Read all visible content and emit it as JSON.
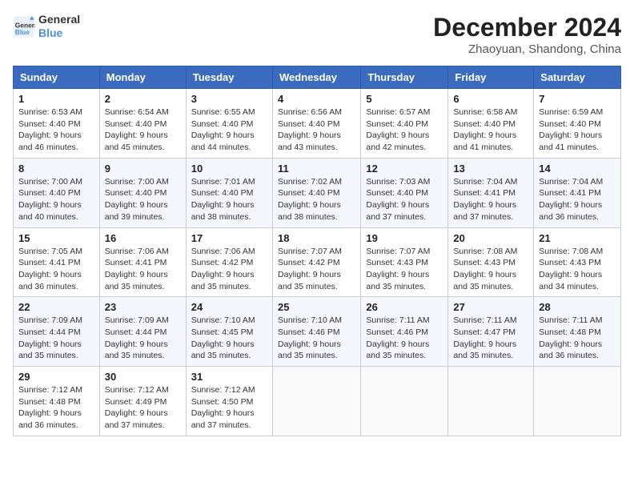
{
  "header": {
    "logo_line1": "General",
    "logo_line2": "Blue",
    "month_title": "December 2024",
    "location": "Zhaoyuan, Shandong, China"
  },
  "weekdays": [
    "Sunday",
    "Monday",
    "Tuesday",
    "Wednesday",
    "Thursday",
    "Friday",
    "Saturday"
  ],
  "weeks": [
    [
      {
        "day": "1",
        "sunrise": "6:53 AM",
        "sunset": "4:40 PM",
        "daylight": "9 hours and 46 minutes."
      },
      {
        "day": "2",
        "sunrise": "6:54 AM",
        "sunset": "4:40 PM",
        "daylight": "9 hours and 45 minutes."
      },
      {
        "day": "3",
        "sunrise": "6:55 AM",
        "sunset": "4:40 PM",
        "daylight": "9 hours and 44 minutes."
      },
      {
        "day": "4",
        "sunrise": "6:56 AM",
        "sunset": "4:40 PM",
        "daylight": "9 hours and 43 minutes."
      },
      {
        "day": "5",
        "sunrise": "6:57 AM",
        "sunset": "4:40 PM",
        "daylight": "9 hours and 42 minutes."
      },
      {
        "day": "6",
        "sunrise": "6:58 AM",
        "sunset": "4:40 PM",
        "daylight": "9 hours and 41 minutes."
      },
      {
        "day": "7",
        "sunrise": "6:59 AM",
        "sunset": "4:40 PM",
        "daylight": "9 hours and 41 minutes."
      }
    ],
    [
      {
        "day": "8",
        "sunrise": "7:00 AM",
        "sunset": "4:40 PM",
        "daylight": "9 hours and 40 minutes."
      },
      {
        "day": "9",
        "sunrise": "7:00 AM",
        "sunset": "4:40 PM",
        "daylight": "9 hours and 39 minutes."
      },
      {
        "day": "10",
        "sunrise": "7:01 AM",
        "sunset": "4:40 PM",
        "daylight": "9 hours and 38 minutes."
      },
      {
        "day": "11",
        "sunrise": "7:02 AM",
        "sunset": "4:40 PM",
        "daylight": "9 hours and 38 minutes."
      },
      {
        "day": "12",
        "sunrise": "7:03 AM",
        "sunset": "4:40 PM",
        "daylight": "9 hours and 37 minutes."
      },
      {
        "day": "13",
        "sunrise": "7:04 AM",
        "sunset": "4:41 PM",
        "daylight": "9 hours and 37 minutes."
      },
      {
        "day": "14",
        "sunrise": "7:04 AM",
        "sunset": "4:41 PM",
        "daylight": "9 hours and 36 minutes."
      }
    ],
    [
      {
        "day": "15",
        "sunrise": "7:05 AM",
        "sunset": "4:41 PM",
        "daylight": "9 hours and 36 minutes."
      },
      {
        "day": "16",
        "sunrise": "7:06 AM",
        "sunset": "4:41 PM",
        "daylight": "9 hours and 35 minutes."
      },
      {
        "day": "17",
        "sunrise": "7:06 AM",
        "sunset": "4:42 PM",
        "daylight": "9 hours and 35 minutes."
      },
      {
        "day": "18",
        "sunrise": "7:07 AM",
        "sunset": "4:42 PM",
        "daylight": "9 hours and 35 minutes."
      },
      {
        "day": "19",
        "sunrise": "7:07 AM",
        "sunset": "4:43 PM",
        "daylight": "9 hours and 35 minutes."
      },
      {
        "day": "20",
        "sunrise": "7:08 AM",
        "sunset": "4:43 PM",
        "daylight": "9 hours and 35 minutes."
      },
      {
        "day": "21",
        "sunrise": "7:08 AM",
        "sunset": "4:43 PM",
        "daylight": "9 hours and 34 minutes."
      }
    ],
    [
      {
        "day": "22",
        "sunrise": "7:09 AM",
        "sunset": "4:44 PM",
        "daylight": "9 hours and 35 minutes."
      },
      {
        "day": "23",
        "sunrise": "7:09 AM",
        "sunset": "4:44 PM",
        "daylight": "9 hours and 35 minutes."
      },
      {
        "day": "24",
        "sunrise": "7:10 AM",
        "sunset": "4:45 PM",
        "daylight": "9 hours and 35 minutes."
      },
      {
        "day": "25",
        "sunrise": "7:10 AM",
        "sunset": "4:46 PM",
        "daylight": "9 hours and 35 minutes."
      },
      {
        "day": "26",
        "sunrise": "7:11 AM",
        "sunset": "4:46 PM",
        "daylight": "9 hours and 35 minutes."
      },
      {
        "day": "27",
        "sunrise": "7:11 AM",
        "sunset": "4:47 PM",
        "daylight": "9 hours and 35 minutes."
      },
      {
        "day": "28",
        "sunrise": "7:11 AM",
        "sunset": "4:48 PM",
        "daylight": "9 hours and 36 minutes."
      }
    ],
    [
      {
        "day": "29",
        "sunrise": "7:12 AM",
        "sunset": "4:48 PM",
        "daylight": "9 hours and 36 minutes."
      },
      {
        "day": "30",
        "sunrise": "7:12 AM",
        "sunset": "4:49 PM",
        "daylight": "9 hours and 37 minutes."
      },
      {
        "day": "31",
        "sunrise": "7:12 AM",
        "sunset": "4:50 PM",
        "daylight": "9 hours and 37 minutes."
      },
      null,
      null,
      null,
      null
    ]
  ],
  "labels": {
    "sunrise": "Sunrise:",
    "sunset": "Sunset:",
    "daylight": "Daylight:"
  }
}
